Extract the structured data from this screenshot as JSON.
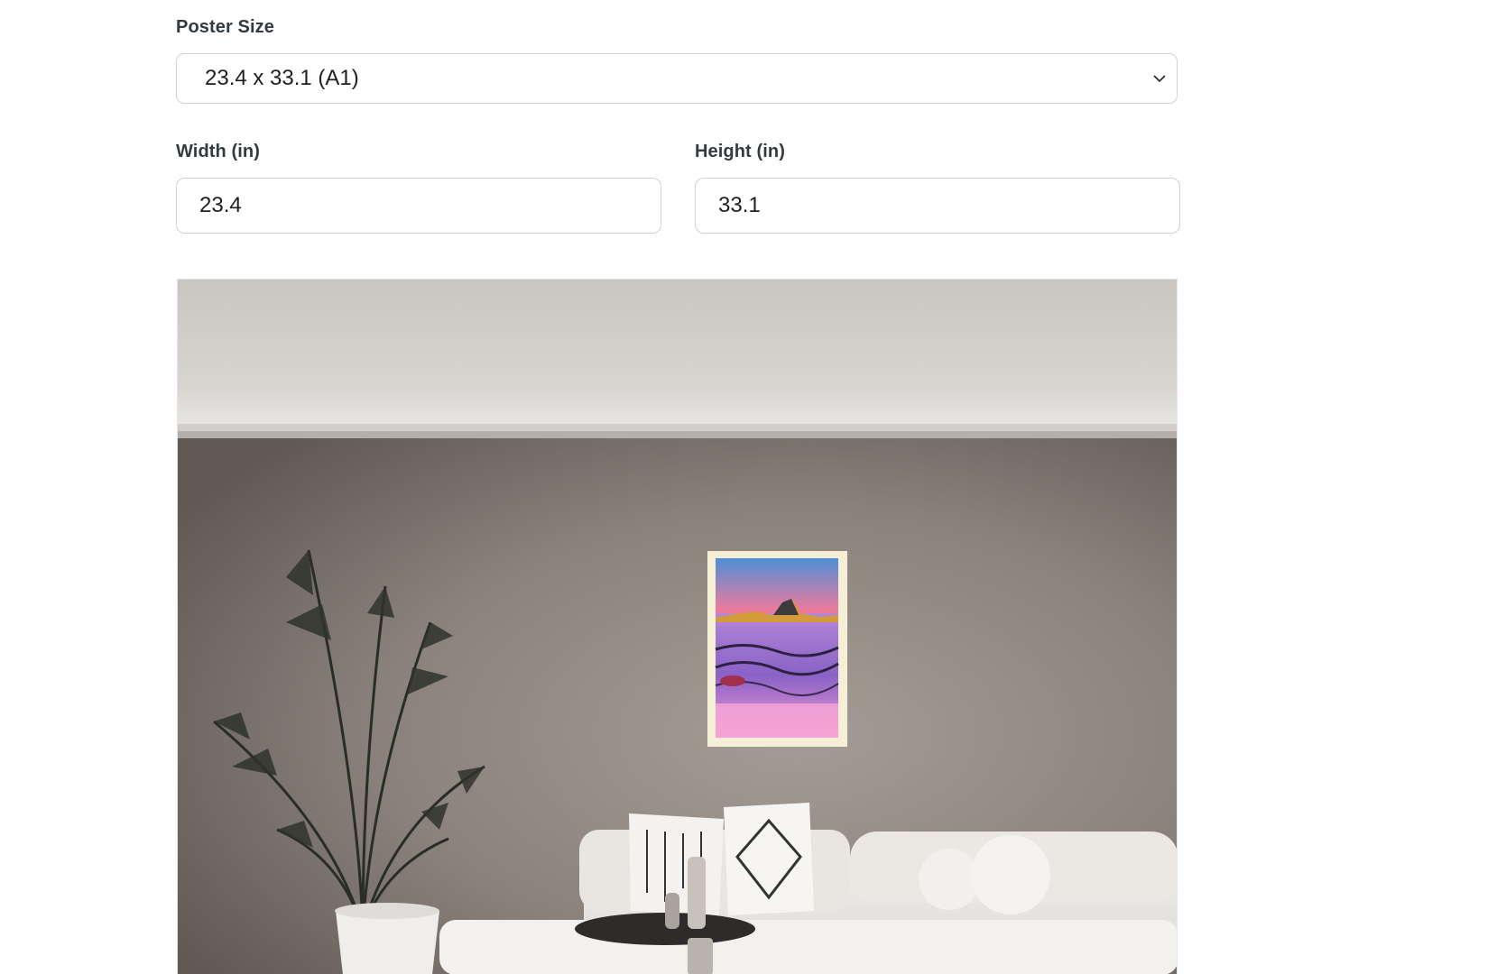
{
  "form": {
    "poster_size_label": "Poster Size",
    "poster_size_value": "23.4 x 33.1 (A1)",
    "width_label": "Width (in)",
    "width_value": "23.4",
    "height_label": "Height (in)",
    "height_value": "33.1"
  },
  "preview": {
    "icons": {
      "dropdown": "chevron-down-icon"
    },
    "colors": {
      "field_border": "#c9d3dc",
      "wall": "#7d7670",
      "ceiling": "#cfccc8",
      "poster_frame": "#f5efd6"
    }
  }
}
